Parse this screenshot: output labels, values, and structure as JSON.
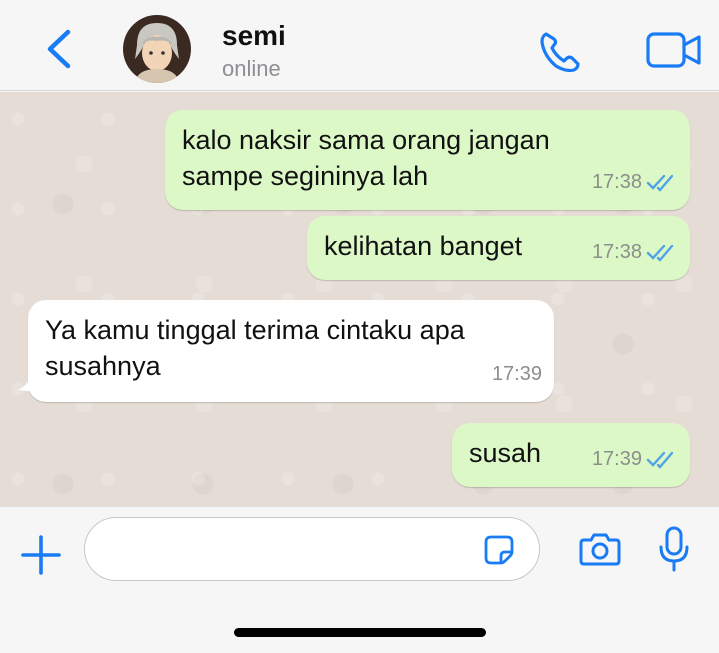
{
  "header": {
    "contact_name": "semi",
    "contact_status": "online",
    "icons": [
      "chevron-left-icon",
      "avatar",
      "phone-icon",
      "video-camera-icon"
    ]
  },
  "messages": [
    {
      "direction": "out",
      "text": "kalo naksir sama orang jangan\nsampe segininya lah",
      "time": "17:38",
      "status": "read"
    },
    {
      "direction": "out",
      "text": "kelihatan banget",
      "time": "17:38",
      "status": "read"
    },
    {
      "direction": "in",
      "text": "Ya kamu tinggal terima cintaku apa\nsusahnya",
      "time": "17:39"
    },
    {
      "direction": "out",
      "text": "susah",
      "time": "17:39",
      "status": "read"
    }
  ],
  "input": {
    "value": "",
    "placeholder": "",
    "icons": [
      "plus-icon",
      "sticker-icon",
      "camera-icon",
      "microphone-icon"
    ]
  },
  "colors": {
    "accent": "#1a7cf5",
    "outgoing_bubble": "#dcf8c6",
    "incoming_bubble": "#ffffff",
    "chat_background": "#e5ddd5",
    "read_tick": "#4fa3e8"
  }
}
